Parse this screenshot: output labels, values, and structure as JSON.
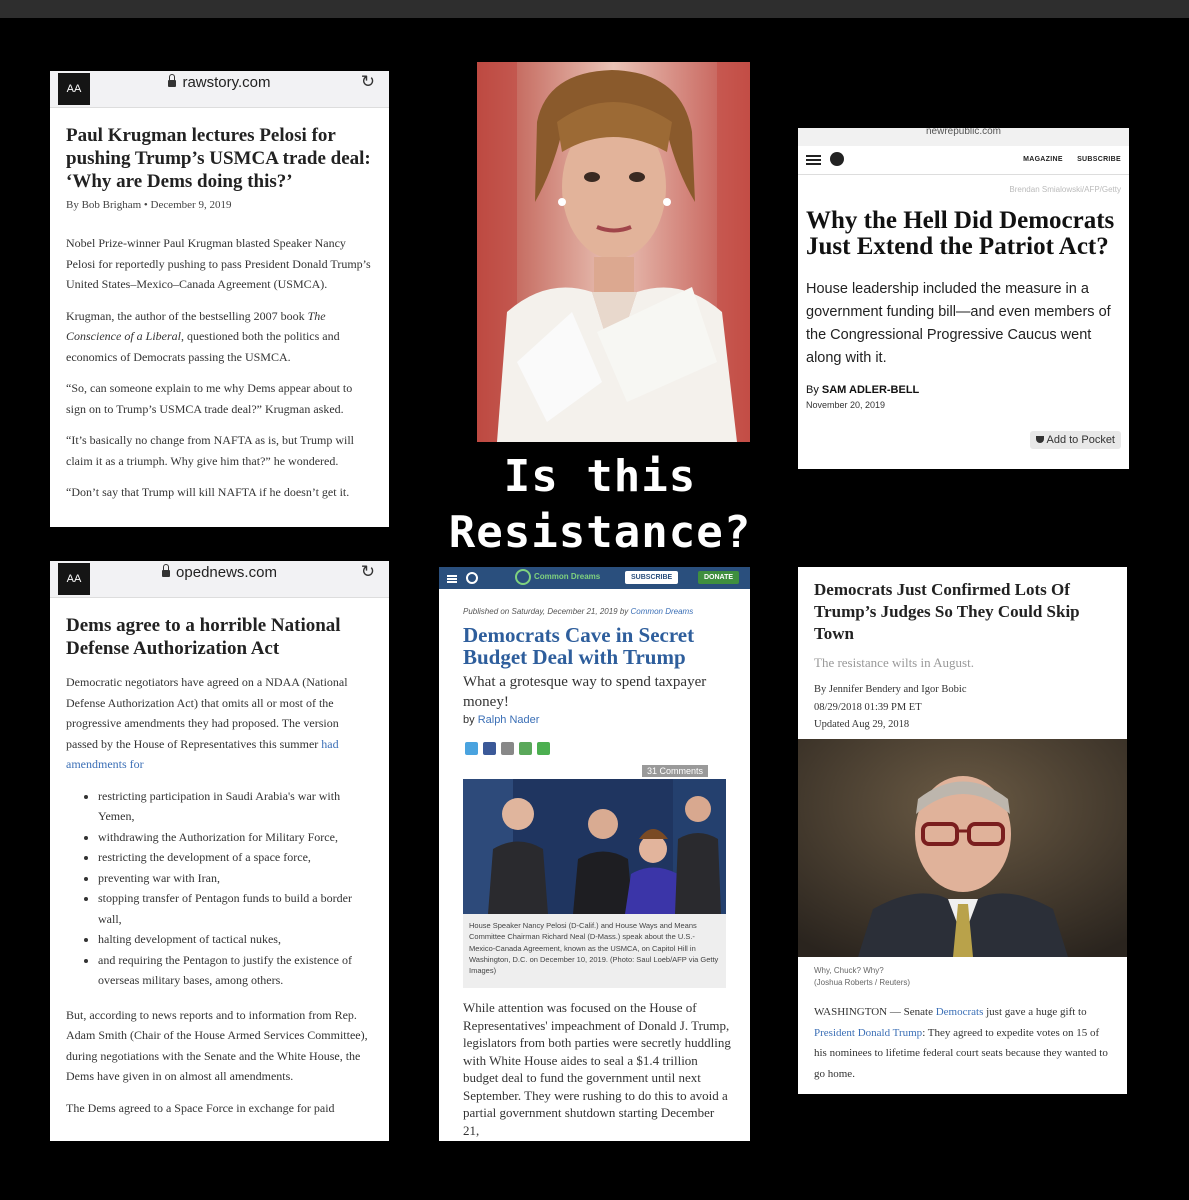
{
  "overlay": {
    "line1": "Is this",
    "line2": "Resistance?"
  },
  "card1": {
    "aa": "AA",
    "url": "rawstory.com",
    "reload_icon": "reload-icon",
    "headline": "Paul Krugman lectures Pelosi for pushing Trump’s USMCA trade deal: ‘Why are Dems doing this?’",
    "byline": "By Bob Brigham  •  December 9, 2019",
    "p1": "Nobel Prize-winner Paul Krugman blasted Speaker Nancy Pelosi for reportedly pushing to pass President Donald Trump’s United States–Mexico–Canada Agreement (USMCA).",
    "p2a": "Krugman, the author of the bestselling 2007 book ",
    "p2i": "The Conscience of a Liberal",
    "p2b": ", questioned both the politics and economics of Democrats passing the USMCA.",
    "p3": "“So, can someone explain to me why Dems appear about to sign on to Trump’s USMCA trade deal?” Krugman asked.",
    "p4": "“It’s basically no change from NAFTA as is, but Trump will claim it as a triumph. Why give him that?” he wondered.",
    "p5": "“Don’t say that Trump will kill NAFTA if he doesn’t get it."
  },
  "card2": {
    "top_url": "newrepublic.com",
    "nav_magazine": "MAGAZINE",
    "nav_subscribe": "SUBSCRIBE",
    "credit": "Brendan Smialowski/AFP/Getty",
    "headline": "Why the Hell Did Democrats Just Extend the Patriot Act?",
    "deck": "House leadership included the measure in a government funding bill—and even members of the Congressional Progressive Caucus went along with it.",
    "by_prefix": "By ",
    "author": "SAM ADLER-BELL",
    "date": "November 20, 2019",
    "pocket": "Add to Pocket"
  },
  "card3": {
    "aa": "AA",
    "url": "opednews.com",
    "headline": "Dems agree to a horrible National Defense Authorization Act",
    "p1": "Democratic negotiators have agreed on a NDAA (National Defense Authorization Act) that omits all or most of the progressive amendments they had proposed. The version passed by the House of Representatives this summer ",
    "p1_link": "had amendments for",
    "bullets": [
      "restricting participation in Saudi Arabia's war with Yemen,",
      "withdrawing the Authorization for Military Force,",
      "restricting the development of a space force,",
      "preventing war with Iran,",
      "stopping transfer of Pentagon funds to build a border wall,",
      "halting development of tactical nukes,",
      "and requiring the Pentagon to justify the existence of overseas military bases, among others."
    ],
    "p2": "But, according to news reports and to information from Rep. Adam Smith (Chair of the House Armed Services Committee), during negotiations with the Senate and the White House, the Dems have given in on almost all amendments.",
    "p3": "The Dems agreed to a Space Force in exchange for paid"
  },
  "card4": {
    "logo": "Common Dreams",
    "subscribe": "SUBSCRIBE",
    "donate": "DONATE",
    "pub_prefix": "Published on Saturday, December 21, 2019 by ",
    "pub_source": "Common Dreams",
    "headline": "Democrats Cave in Secret Budget Deal with Trump",
    "deck": "What a grotesque way to spend taxpayer money!",
    "by_prefix": "by ",
    "author": "Ralph Nader",
    "comments": "31 Comments",
    "caption": "House Speaker Nancy Pelosi (D-Calif.) and House Ways and Means Committee Chairman Richard Neal (D-Mass.) speak about the U.S.-Mexico-Canada Agreement, known as the USMCA, on Capitol Hill in Washington, D.C. on December 10, 2019. (Photo: Saul Loeb/AFP via Getty Images)",
    "body": "While attention was focused on the House of Representatives' impeachment of Donald J. Trump, legislators from both parties were secretly huddling with White House aides to seal a $1.4 trillion budget deal to fund the government until next September. They were rushing to do this to avoid a partial government shutdown starting December 21,"
  },
  "card5": {
    "headline": "Democrats Just Confirmed Lots Of Trump’s Judges So They Could Skip Town",
    "deck": "The resistance wilts in August.",
    "byline": "By Jennifer Bendery and Igor Bobic",
    "timestamp": "08/29/2018 01:39 PM ET",
    "updated": "Updated Aug 29, 2018",
    "caption1": "Why, Chuck? Why?",
    "caption2": "(Joshua Roberts / Reuters)",
    "body_a": "WASHINGTON — Senate ",
    "body_link1": "Democrats",
    "body_b": " just gave a huge gift to ",
    "body_link2": "President Donald Trump",
    "body_c": ": They agreed to expedite votes on 15 of his nominees to lifetime federal court seats because they wanted to go home."
  },
  "colors": {
    "link": "#3b6fb6",
    "cd_headline": "#2e5e9c",
    "cd_bar": "#2a4f7d"
  }
}
